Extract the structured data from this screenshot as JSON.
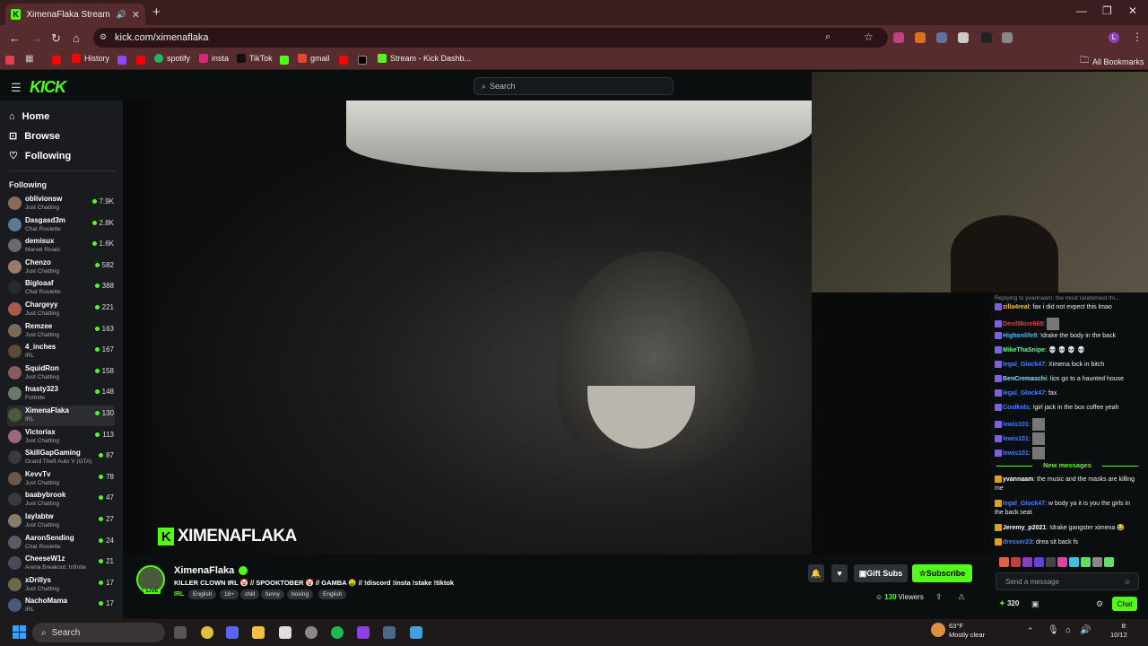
{
  "browser": {
    "tab_title": "XimenaFlaka Stream - Watc",
    "url": "kick.com/ximenaflaka",
    "bookmarks": [
      "History",
      "spotify",
      "insta",
      "TikTok",
      "gmail",
      "Stream - Kick Dashb...",
      "All Bookmarks"
    ]
  },
  "site": {
    "logo": "KICK",
    "search_placeholder": "Search",
    "nav": [
      {
        "label": "Home",
        "icon": "home-icon"
      },
      {
        "label": "Browse",
        "icon": "compass-icon"
      },
      {
        "label": "Following",
        "icon": "heart-icon"
      }
    ],
    "following_heading": "Following"
  },
  "following": [
    {
      "name": "oblivionsw",
      "category": "Just Chatting",
      "viewers": "7.9K",
      "color": "#8a6a5a"
    },
    {
      "name": "Dasgasd3m",
      "category": "Chat Roulette",
      "viewers": "2.8K",
      "color": "#5a7a9a"
    },
    {
      "name": "demisux",
      "category": "Marvel Rivals",
      "viewers": "1.6K",
      "color": "#6a6a6a"
    },
    {
      "name": "Chenzo",
      "category": "Just Chatting",
      "viewers": "582",
      "color": "#9a7a6a"
    },
    {
      "name": "Bigloaaf",
      "category": "Chat Roulette",
      "viewers": "388",
      "color": "#2a2a2a"
    },
    {
      "name": "Chargeyy",
      "category": "Just Chatting",
      "viewers": "221",
      "color": "#aa5a4a"
    },
    {
      "name": "Remzee",
      "category": "Just Chatting",
      "viewers": "163",
      "color": "#7a6a5a"
    },
    {
      "name": "4_inches",
      "category": "IRL",
      "viewers": "167",
      "color": "#5a4a3a"
    },
    {
      "name": "SquidRon",
      "category": "Just Chatting",
      "viewers": "158",
      "color": "#8a5a5a"
    },
    {
      "name": "fnasty323",
      "category": "Fortnite",
      "viewers": "148",
      "color": "#6a7a6a"
    },
    {
      "name": "XimenaFlaka",
      "category": "IRL",
      "viewers": "130",
      "color": "#4a5a3a"
    },
    {
      "name": "Victoriax",
      "category": "Just Chatting",
      "viewers": "113",
      "color": "#9a6a7a"
    },
    {
      "name": "SkillGapGaming",
      "category": "Grand Theft Auto V (GTA)",
      "viewers": "87",
      "color": "#3a3a3a"
    },
    {
      "name": "KevvTv",
      "category": "Just Chatting",
      "viewers": "78",
      "color": "#6a5a4a"
    },
    {
      "name": "baabybrook",
      "category": "Just Chatting",
      "viewers": "47",
      "color": "#3a3a3a"
    },
    {
      "name": "laylabtw",
      "category": "Just Chatting",
      "viewers": "27",
      "color": "#8a7a6a"
    },
    {
      "name": "AaronSending",
      "category": "Chat Roulette",
      "viewers": "24",
      "color": "#5a5a6a"
    },
    {
      "name": "CheeseW1z",
      "category": "Arena Breakout: Infinite",
      "viewers": "21",
      "color": "#4a4a5a"
    },
    {
      "name": "xDrillys",
      "category": "Just Chatting",
      "viewers": "17",
      "color": "#6a6a4a"
    },
    {
      "name": "NachoMama",
      "category": "IRL",
      "viewers": "17",
      "color": "#4a5a7a"
    }
  ],
  "stream": {
    "watermark": "XIMENAFLAKA",
    "name": "XimenaFlaka",
    "title": "KILLER CLOWN IRL 🤡 // SPOOKTOBER 🤡 // GAMBA 🤑   // !discord !insta !stake  !tiktok",
    "category": "IRL",
    "tags": [
      "English",
      "18+",
      "chill",
      "funny",
      "boxing",
      "English"
    ],
    "live_label": "LIVE",
    "viewers": "130",
    "viewers_label": "Viewers",
    "gift_subs": "Gift Subs",
    "subscribe": "Subscribe"
  },
  "chat": {
    "reply_note": "Replying to yvannaam: the most randomest thi...",
    "messages": [
      {
        "user": "zilla4real",
        "color": "#f0c040",
        "text": "fax i did not expect this lmao"
      },
      {
        "user": "DevilMore669",
        "color": "#e04040",
        "text": ""
      },
      {
        "user": "Highonlife9",
        "color": "#40c0ff",
        "text": "!drake the body in the back"
      },
      {
        "user": "MikeThaSnipe",
        "color": "#60ff80",
        "text": "💀 💀 💀 💀"
      },
      {
        "user": "legal_Glock47",
        "color": "#4080ff",
        "text": "Ximena lock in bitch"
      },
      {
        "user": "BenCremaschi",
        "color": "#80e0ff",
        "text": "lios go to a haunted house"
      },
      {
        "user": "legal_Glock47",
        "color": "#4080ff",
        "text": "fax"
      },
      {
        "user": "Coolkids",
        "color": "#4080ff",
        "text": "!girl jack in the box coffee yeah"
      },
      {
        "user": "lewis101",
        "color": "#4080ff",
        "text": ""
      },
      {
        "user": "lewis101",
        "color": "#4080ff",
        "text": ""
      },
      {
        "user": "lewis101",
        "color": "#4080ff",
        "text": ""
      }
    ],
    "new_messages_label": "New messages",
    "new_messages": [
      {
        "user": "yvannaam",
        "color": "#ffffff",
        "text": "the music and the masks are killing me"
      },
      {
        "user": "legal_Glock47",
        "color": "#4080ff",
        "text": "w body ya it is you the girls in the back seat"
      },
      {
        "user": "Jeremy_p2021",
        "color": "#ffffff",
        "text": "!drake gangster ximena 😂"
      },
      {
        "user": "dresser23",
        "color": "#4080ff",
        "text": "drea sit back fs"
      }
    ],
    "input_placeholder": "Send a message",
    "points": "320",
    "chat_button": "Chat"
  },
  "taskbar": {
    "search": "Search",
    "temperature": "63°F",
    "weather": "Mostly clear",
    "time": "8:",
    "date": "10/12"
  }
}
